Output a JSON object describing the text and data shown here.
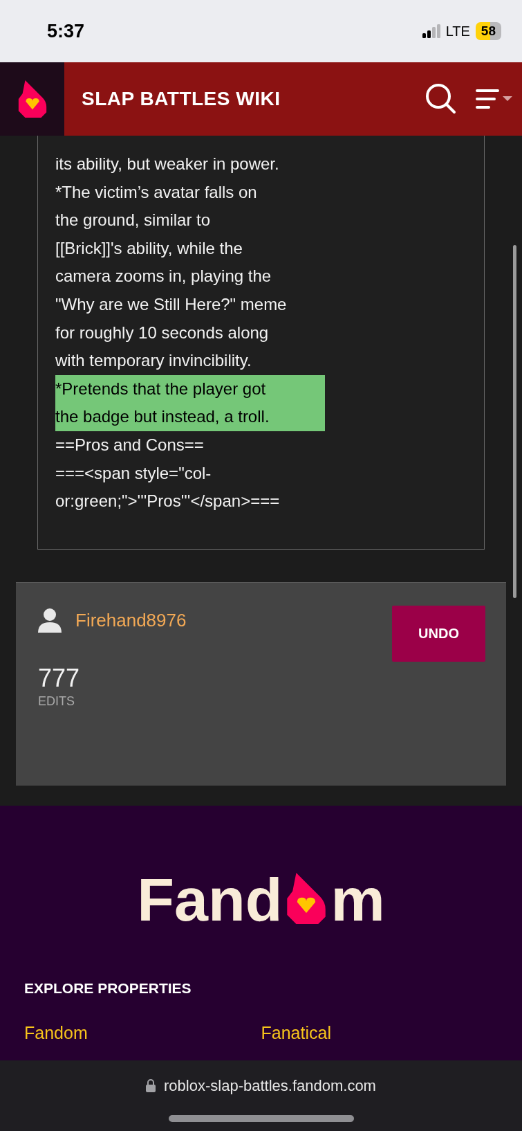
{
  "status_bar": {
    "time": "5:37",
    "network": "LTE",
    "battery": "58"
  },
  "header": {
    "title": "SLAP BATTLES WIKI"
  },
  "source_lines": [
    {
      "text": "its ability, but weaker in power.",
      "highlighted": false
    },
    {
      "text": "*The victim’s avatar falls on",
      "highlighted": false
    },
    {
      "text": "the ground, similar to",
      "highlighted": false
    },
    {
      "text": "[[Brick]]'s ability, while the",
      "highlighted": false
    },
    {
      "text": "camera zooms in, playing the",
      "highlighted": false
    },
    {
      "text": "\"Why are we Still Here?\" meme",
      "highlighted": false
    },
    {
      "text": "for roughly 10 seconds along",
      "highlighted": false
    },
    {
      "text": "with temporary invincibility.",
      "highlighted": false
    },
    {
      "text": "*Pretends that the player got",
      "highlighted": true
    },
    {
      "text": "the badge but instead, a troll.",
      "highlighted": true
    },
    {
      "text": "==Pros and Cons==",
      "highlighted": false
    },
    {
      "text": "===<span style=\"col-",
      "highlighted": false
    },
    {
      "text": "or:green;\">'''Pros'''</span>===",
      "highlighted": false
    }
  ],
  "editor": {
    "username": "Firehand8976",
    "button": "UNDO",
    "edit_count": "777",
    "edit_label": "EDITS"
  },
  "footer": {
    "logo_start": "Fand",
    "logo_end": "m",
    "heading": "EXPLORE PROPERTIES",
    "links": [
      "Fandom",
      "Fanatical"
    ]
  },
  "browser": {
    "url": "roblox-slap-battles.fandom.com"
  }
}
